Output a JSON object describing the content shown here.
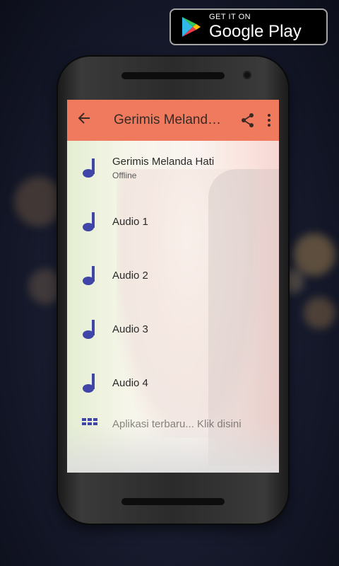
{
  "badge": {
    "small": "GET IT ON",
    "big": "Google Play"
  },
  "appbar": {
    "title": "Gerimis Melanda Hati",
    "back_icon": "arrow-left-icon",
    "share_icon": "share-icon",
    "menu_icon": "more-vert-icon"
  },
  "colors": {
    "appbar": "#f07a5e",
    "accent": "#3f46a8"
  },
  "list": {
    "items": [
      {
        "title": "Gerimis Melanda Hati",
        "subtitle": "Offline",
        "icon": "music-note-icon"
      },
      {
        "title": "Audio 1",
        "icon": "music-note-icon"
      },
      {
        "title": "Audio 2",
        "icon": "music-note-icon"
      },
      {
        "title": "Audio 3",
        "icon": "music-note-icon"
      },
      {
        "title": "Audio 4",
        "icon": "music-note-icon"
      }
    ],
    "partial_item": {
      "title": "Aplikasi terbaru... Klik disini",
      "icon": "apps-icon"
    }
  }
}
